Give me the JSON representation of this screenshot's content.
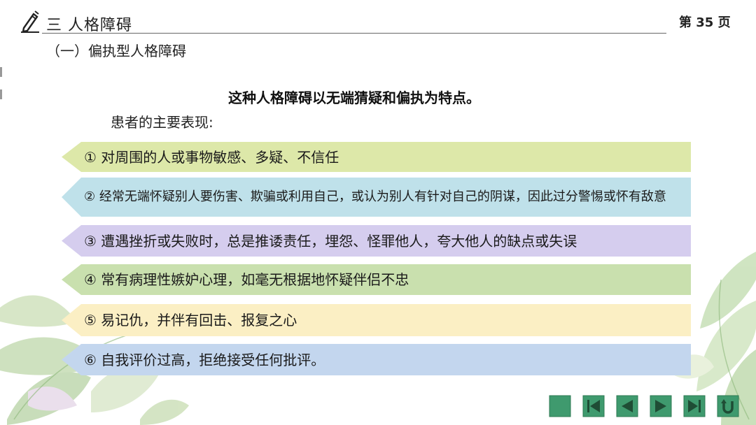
{
  "header": {
    "section_title": "三  人格障碍",
    "page_label": "第 35 页"
  },
  "subsection": "（一）偏执型人格障碍",
  "summary": "这种人格障碍以无端猜疑和偏执为特点。",
  "symptom_intro": "患者的主要表现:",
  "items": [
    {
      "label": "① 对周围的人或事物敏感、多疑、不信任",
      "color": "#dde8a9"
    },
    {
      "label": "② 经常无端怀疑别人要伤害、欺骗或利用自己，或认为别人有针对自己的阴谋，因此过分警惕或怀有敌意",
      "color": "#bfe1ea"
    },
    {
      "label": "③ 遭遇挫折或失败时，总是推诿责任，埋怨、怪罪他人，夸大他人的缺点或失误",
      "color": "#d5cdee"
    },
    {
      "label": "④ 常有病理性嫉妒心理，如毫无根据地怀疑伴侣不忠",
      "color": "#c9e0ae"
    },
    {
      "label": "⑤ 易记仇，并伴有回击、报复之心",
      "color": "#fbefc4"
    },
    {
      "label": "⑥ 自我评价过高，拒绝接受任何批评。",
      "color": "#c3d6ee"
    }
  ],
  "nav": {
    "buttons": [
      "home-icon",
      "first-page-icon",
      "prev-icon",
      "next-icon",
      "last-page-icon",
      "return-icon"
    ],
    "color": "#3f9a6e"
  },
  "icons": {
    "header": "pencil-icon"
  }
}
